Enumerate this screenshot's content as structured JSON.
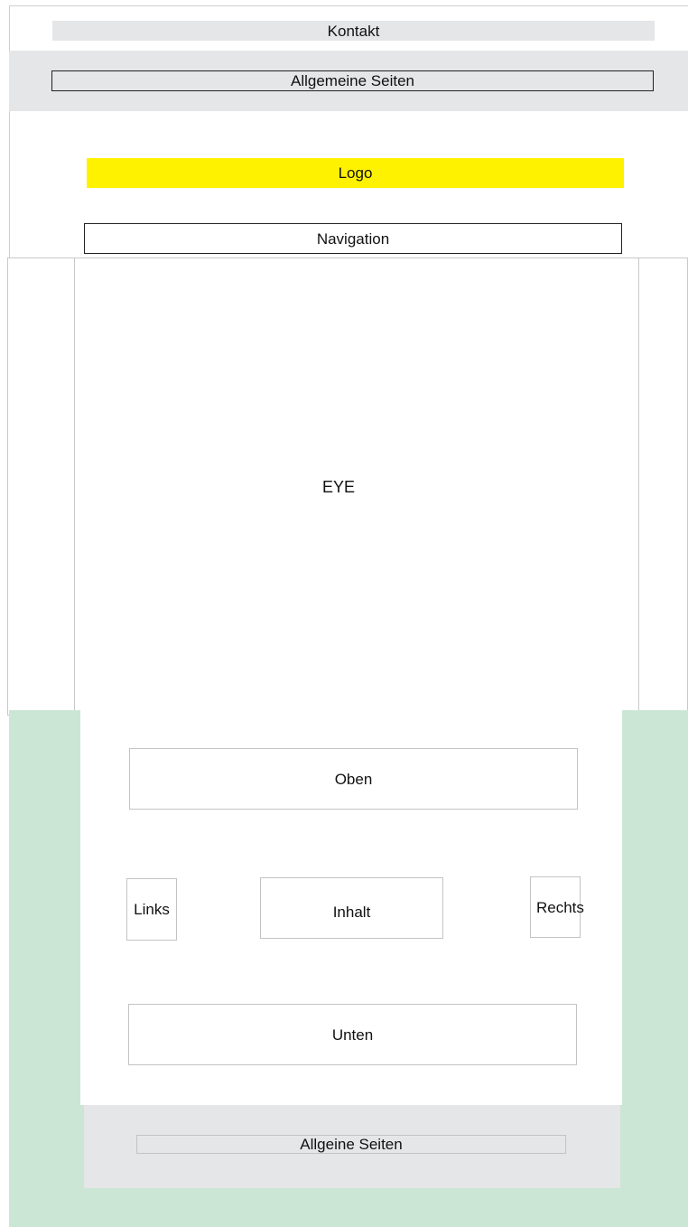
{
  "header": {
    "contact_label": "Kontakt",
    "general_pages_label": "Allgemeine Seiten",
    "logo_label": "Logo",
    "navigation_label": "Navigation"
  },
  "hero": {
    "label": "EYE"
  },
  "content": {
    "top_label": "Oben",
    "left_label": "Links",
    "main_label": "Inhalt",
    "right_label": "Rechts",
    "bottom_label": "Unten"
  },
  "footer": {
    "general_pages_label": "Allgeine Seiten"
  },
  "colors": {
    "logo_fill": "#fff200",
    "band_gray": "#e5e6e7",
    "green_background": "#cce6d6"
  }
}
